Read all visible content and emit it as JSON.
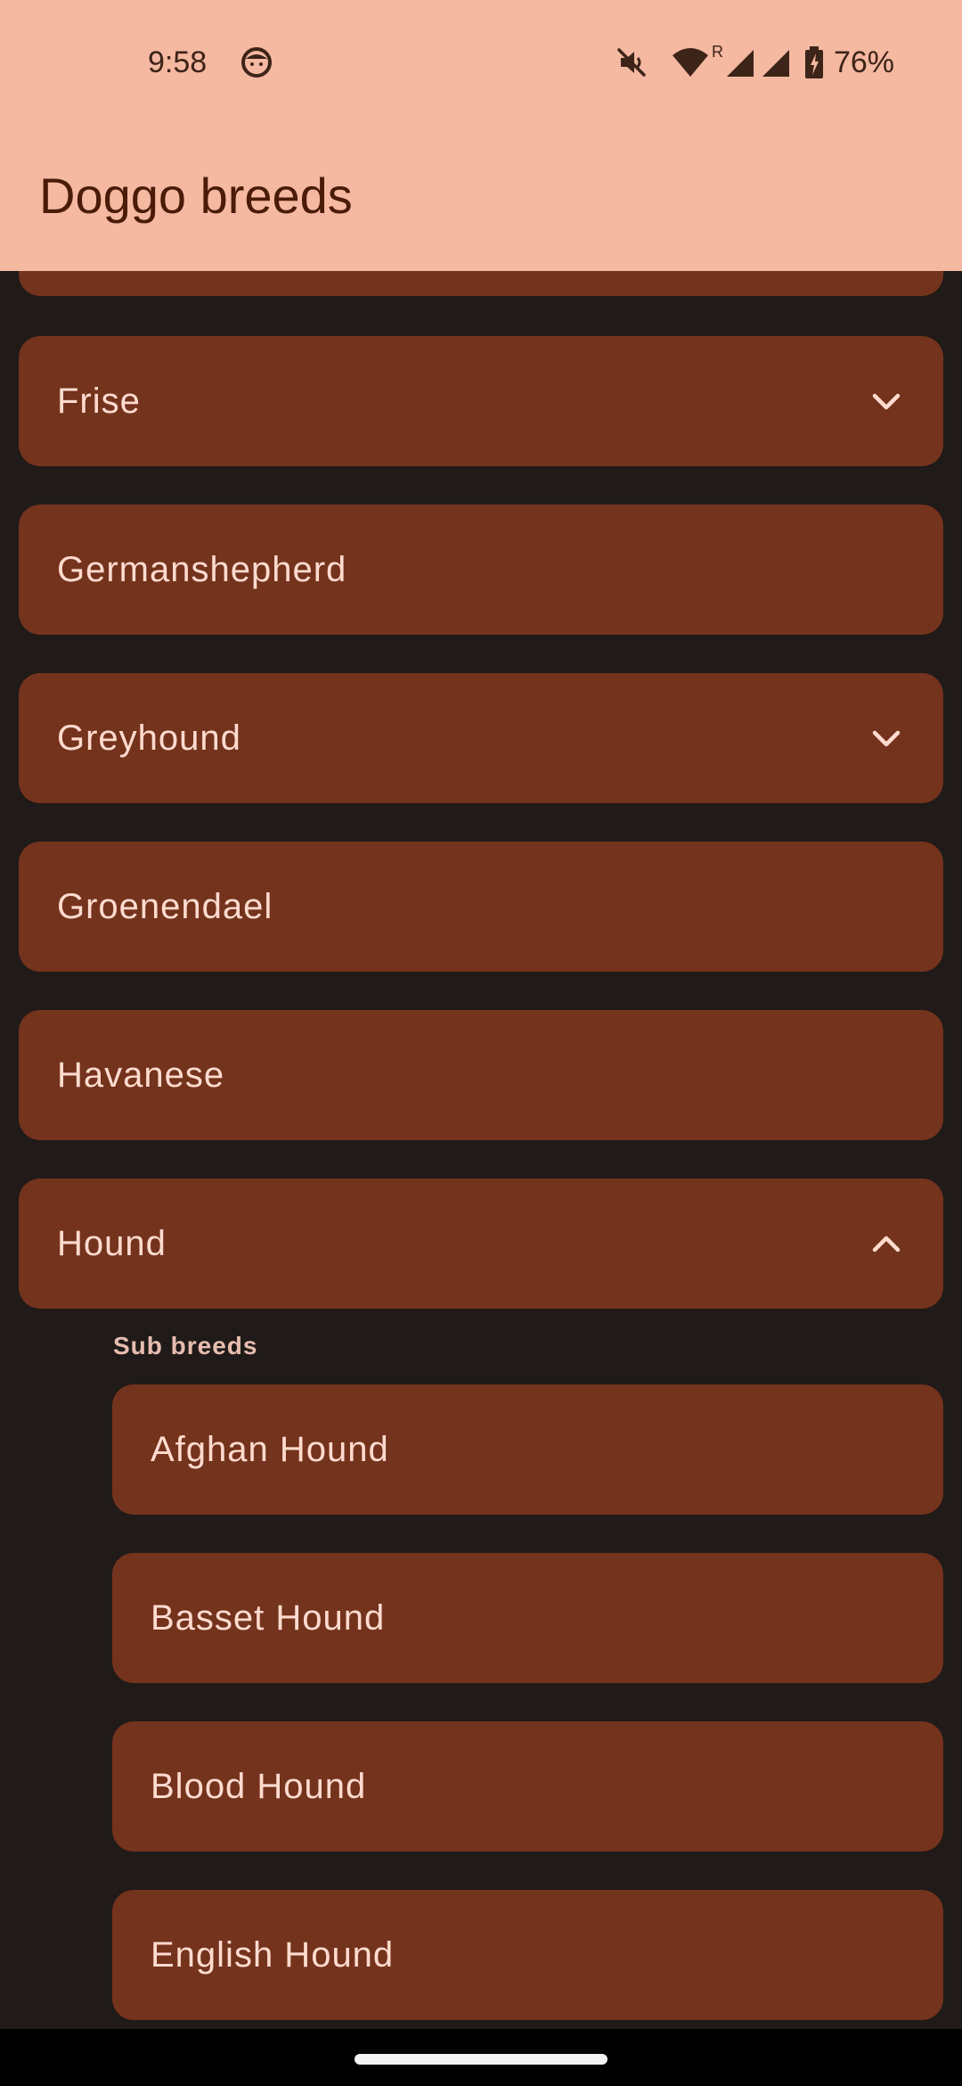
{
  "status_bar": {
    "time": "9:58",
    "battery": "76%",
    "roaming_indicator": "R",
    "icons": [
      "android-face-icon",
      "mute-icon",
      "wifi-icon",
      "signal-icon",
      "signal-icon-2",
      "battery-charging-icon"
    ]
  },
  "app_bar": {
    "title": "Doggo breeds"
  },
  "breeds": [
    {
      "label": "Frise",
      "expandable": true,
      "expanded": false
    },
    {
      "label": "Germanshepherd",
      "expandable": false
    },
    {
      "label": "Greyhound",
      "expandable": true,
      "expanded": false
    },
    {
      "label": "Groenendael",
      "expandable": false
    },
    {
      "label": "Havanese",
      "expandable": false
    },
    {
      "label": "Hound",
      "expandable": true,
      "expanded": true
    }
  ],
  "sub_breeds": {
    "header": "Sub breeds",
    "items": [
      {
        "label": "Afghan Hound"
      },
      {
        "label": "Basset Hound"
      },
      {
        "label": "Blood Hound"
      },
      {
        "label": "English Hound"
      }
    ]
  },
  "colors": {
    "app_bar": "#f5b8a1",
    "background": "#201a19",
    "card": "#74331c",
    "card_text": "#ffdbcf",
    "title_text": "#4a1c08"
  }
}
